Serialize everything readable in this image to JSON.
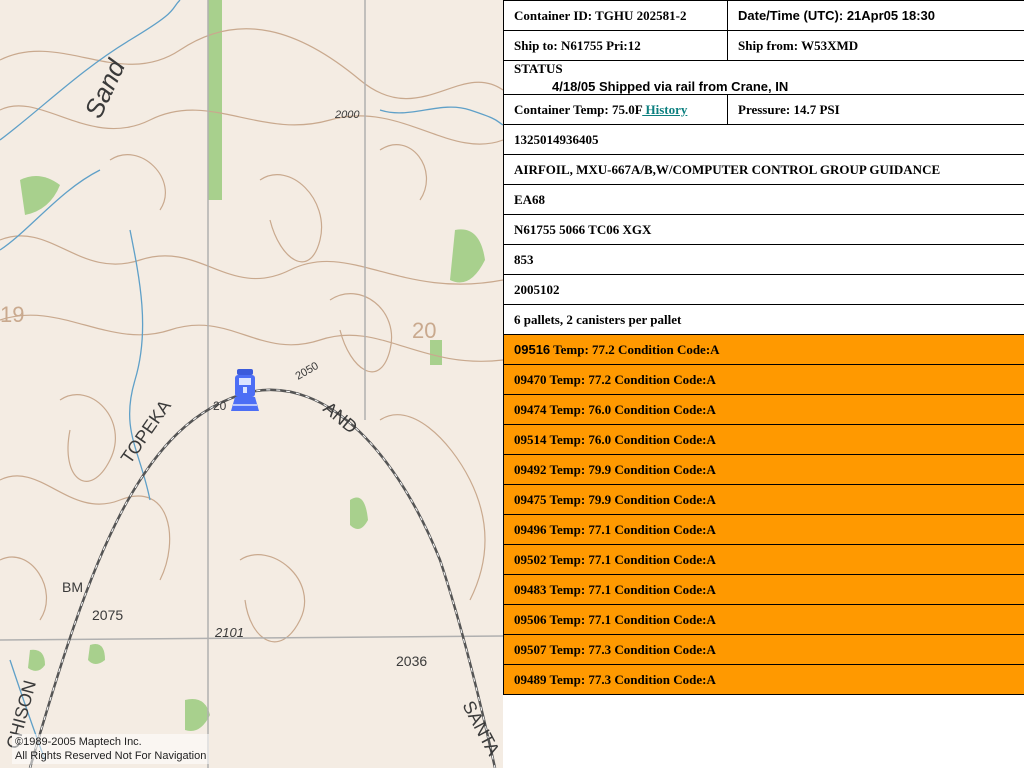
{
  "map": {
    "labels": {
      "sand": "Sand",
      "topeka": "TOPEKA",
      "and": "AND",
      "santa": "SANTA",
      "hutchison": "CHISON",
      "bm": "BM",
      "elev_2075": "2075",
      "elev_2101": "2101",
      "elev_2036": "2036",
      "elev_2050": "2050",
      "elev_2000": "2000",
      "num_20a": "20",
      "num_20b": "20",
      "num_19": "19"
    },
    "copyright_line1": "©1989-2005 Maptech Inc.",
    "copyright_line2": "All Rights Reserved Not For Navigation",
    "colors": {
      "contour": "#c9a98e",
      "grid": "#b0b0b0",
      "water": "#5fa0c8",
      "rail": "#555555",
      "vegetation": "#a8d08d"
    }
  },
  "panel": {
    "container_id": "Container ID: TGHU 202581-2",
    "datetime": "Date/Time (UTC): 21Apr05 18:30",
    "ship_to": "Ship to: N61755 Pri:12",
    "ship_from": "Ship from: W53XMD",
    "status_label": "STATUS",
    "status_text": "4/18/05 Shipped via rail from Crane, IN",
    "container_temp": "Container Temp: 75.0F",
    "history_link": " History",
    "pressure": "Pressure: 14.7 PSI",
    "rows": [
      "1325014936405",
      "AIRFOIL, MXU-667A/B,W/COMPUTER CONTROL GROUP GUIDANCE",
      "EA68",
      "N61755 5066 TC06 XGX",
      "853",
      "2005102",
      "6 pallets, 2 canisters per pallet"
    ],
    "canisters": [
      {
        "id": "09516",
        "text": " Temp: 77.2 Condition Code:A"
      },
      {
        "id": "09470",
        "text": "  Temp: 77.2 Condition Code:A"
      },
      {
        "id": "09474",
        "text": " Temp: 76.0 Condition Code:A"
      },
      {
        "id": "09514",
        "text": " Temp: 76.0 Condition Code:A"
      },
      {
        "id": "09492",
        "text": " Temp: 79.9 Condition Code:A"
      },
      {
        "id": "09475",
        "text": " Temp: 79.9 Condition Code:A"
      },
      {
        "id": "09496",
        "text": " Temp: 77.1 Condition Code:A"
      },
      {
        "id": "09502",
        "text": " Temp: 77.1 Condition Code:A"
      },
      {
        "id": "09483",
        "text": " Temp: 77.1 Condition Code:A"
      },
      {
        "id": "09506",
        "text": " Temp: 77.1 Condition Code:A"
      },
      {
        "id": "09507",
        "text": " Temp: 77.3 Condition Code:A"
      },
      {
        "id": "09489",
        "text": " Temp: 77.3 Condition Code:A"
      }
    ],
    "colors": {
      "canister_row": "#ff9900",
      "link": "#0b7f7f",
      "border": "#000000"
    }
  }
}
